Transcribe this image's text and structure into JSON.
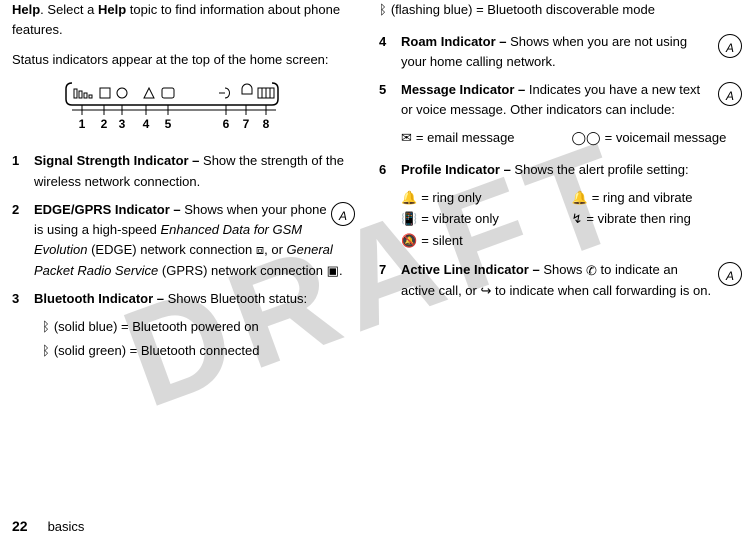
{
  "left": {
    "intro_pre": "Help",
    "intro_mid": ". Select a ",
    "intro_bold2": "Help",
    "intro_post": " topic to find information about phone features.",
    "status_line": "Status indicators appear at the top of the home screen:",
    "item1": {
      "num": "1",
      "title": "Signal Strength Indicator – ",
      "text": "Show the strength of the wireless network connection."
    },
    "item2": {
      "num": "2",
      "title": "EDGE/GPRS Indicator – ",
      "t1": "Shows when your phone is using a high-speed ",
      "it1": "Enhanced Data for GSM Evolution",
      "t2": " (EDGE) network connection ",
      "t3": ", or ",
      "it2": "General Packet Radio Service",
      "t4": " (GPRS) network connection ",
      "t5": "."
    },
    "item3": {
      "num": "3",
      "title": "Bluetooth Indicator – ",
      "text": "Shows Bluetooth status:"
    },
    "bt1": " (solid blue) = Bluetooth powered on",
    "bt2": " (solid green) = Bluetooth connected",
    "bar_numbers": [
      "1",
      "2",
      "3",
      "4",
      "5",
      "6",
      "7",
      "8"
    ]
  },
  "right": {
    "bt3": " (flashing blue) = Bluetooth discoverable mode",
    "item4": {
      "num": "4",
      "title": "Roam Indicator – ",
      "text": "Shows when you are not using your home calling network."
    },
    "item5": {
      "num": "5",
      "title": "Message Indicator – ",
      "text": "Indicates you have a new text or voice message. Other indicators can include:"
    },
    "msg1": " = email message",
    "msg2": " = voicemail message",
    "item6": {
      "num": "6",
      "title": "Profile Indicator – ",
      "text": "Shows the alert profile setting:"
    },
    "p1": " = ring only",
    "p2": " = ring and vibrate",
    "p3": " = vibrate only",
    "p4": " = vibrate then ring",
    "p5": " = silent",
    "item7": {
      "num": "7",
      "title": "Active Line Indicator – ",
      "t1": "Shows ",
      "t2": " to indicate an active call, or ",
      "t3": " to indicate when call forwarding is on."
    }
  },
  "footer": {
    "page": "22",
    "section": "basics"
  }
}
